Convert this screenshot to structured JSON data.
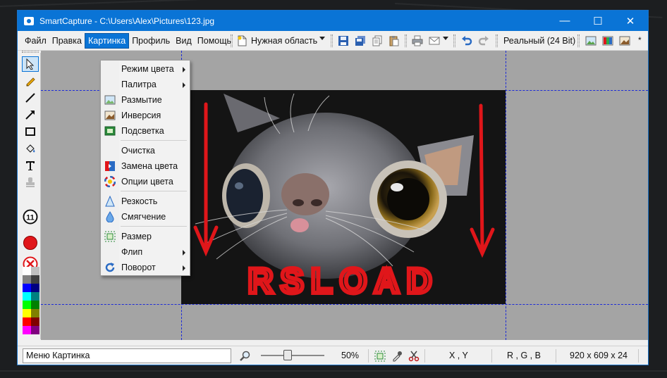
{
  "window": {
    "title": "SmartCapture - C:\\Users\\Alex\\Pictures\\123.jpg",
    "controls": {
      "minimize": "—",
      "maximize": "☐",
      "close": "✕"
    }
  },
  "menubar": {
    "items": [
      "Файл",
      "Правка",
      "Картинка",
      "Профиль",
      "Вид",
      "Помощь"
    ],
    "active_index": 2
  },
  "toolbar": {
    "region_label": "Нужная область",
    "color_mode_label": "Реальный (24 Bit)",
    "overflow": "*",
    "icons": [
      "new-region-icon",
      "save-icon",
      "save-all-icon",
      "copy-icon",
      "paste-icon",
      "print-icon",
      "email-icon",
      "undo-icon",
      "redo-icon",
      "image-icon-1",
      "image-icon-2",
      "image-icon-3"
    ]
  },
  "tools": {
    "items": [
      "pointer-tool",
      "pencil-tool",
      "line-tool",
      "arrow-tool",
      "rectangle-tool",
      "fill-tool",
      "text-tool",
      "stamp-tool",
      "counter-tool",
      "red-color-swatch",
      "no-color-swatch"
    ],
    "counter_label": "11",
    "palette": [
      "#ffffff",
      "#c0c0c0",
      "#808080",
      "#404040",
      "#0000ff",
      "#000080",
      "#00ffff",
      "#008080",
      "#00ff00",
      "#008000",
      "#ffff00",
      "#808000",
      "#ff0000",
      "#800000",
      "#ff00ff",
      "#800080"
    ]
  },
  "dropdown": {
    "items": [
      {
        "label": "Режим цвета",
        "submenu": true
      },
      {
        "label": "Палитра",
        "submenu": true
      },
      {
        "label": "Размытие",
        "icon": "blur-icon"
      },
      {
        "label": "Инверсия",
        "icon": "invert-icon"
      },
      {
        "label": "Подсветка",
        "icon": "highlight-icon"
      },
      {
        "label": "Очистка"
      },
      {
        "label": "Замена цвета",
        "icon": "color-replace-icon"
      },
      {
        "label": "Опции цвета",
        "icon": "color-options-icon"
      },
      {
        "label": "Резкость",
        "icon": "sharpen-icon"
      },
      {
        "label": "Смягчение",
        "icon": "soften-icon"
      },
      {
        "label": "Размер",
        "icon": "resize-icon"
      },
      {
        "label": "Флип",
        "submenu": true
      },
      {
        "label": "Поворот",
        "icon": "rotate-icon",
        "submenu": true
      }
    ]
  },
  "image": {
    "annotation_text": "RSLOAD",
    "annotation_color": "#e0161a"
  },
  "statusbar": {
    "message": "Меню Картинка",
    "zoom": "50%",
    "coords": "X , Y",
    "rgb": "R , G , B",
    "dimensions": "920 x 609 x 24",
    "zoom_fraction": 0.42
  },
  "colors": {
    "titlebar": "#0a74d6",
    "canvas_bg": "#a4a4a4",
    "selection_dash": "#1c2ad8"
  }
}
